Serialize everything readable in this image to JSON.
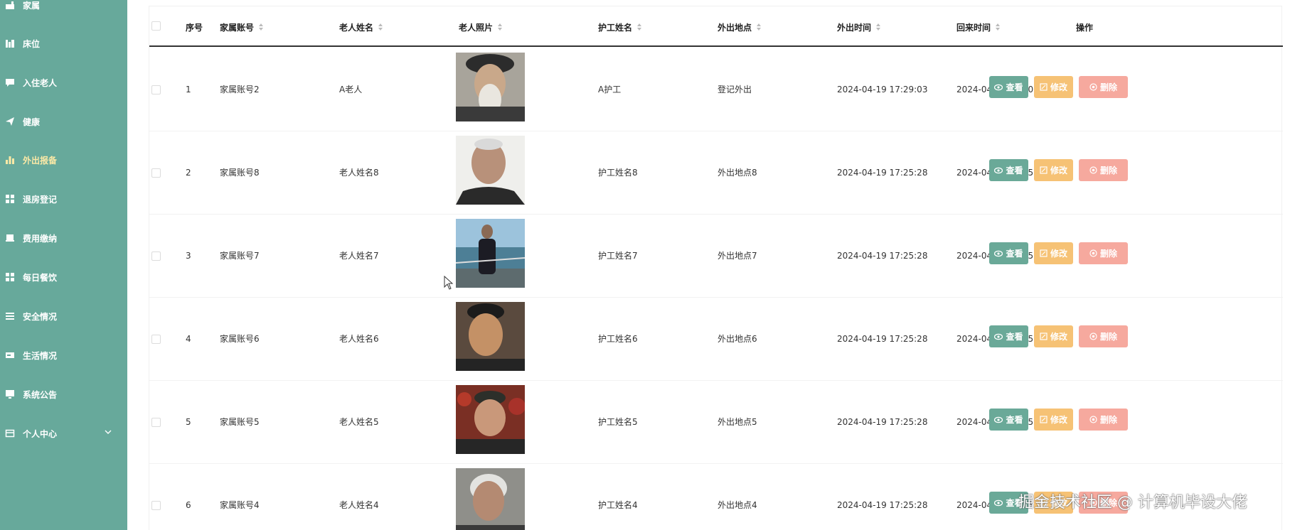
{
  "sidebar": {
    "items": [
      {
        "label": "家属",
        "icon": "family-icon"
      },
      {
        "label": "床位",
        "icon": "bed-icon"
      },
      {
        "label": "入住老人",
        "icon": "chat-icon"
      },
      {
        "label": "健康",
        "icon": "send-icon"
      },
      {
        "label": "外出报备",
        "icon": "bar-chart-icon",
        "active": true
      },
      {
        "label": "退房登记",
        "icon": "grid-icon"
      },
      {
        "label": "费用缴纳",
        "icon": "wallet-icon"
      },
      {
        "label": "每日餐饮",
        "icon": "grid-icon"
      },
      {
        "label": "安全情况",
        "icon": "list-icon"
      },
      {
        "label": "生活情况",
        "icon": "card-icon"
      },
      {
        "label": "系统公告",
        "icon": "monitor-icon"
      },
      {
        "label": "个人中心",
        "icon": "folder-icon"
      }
    ]
  },
  "table": {
    "headers": {
      "index": "序号",
      "family_account": "家属账号",
      "elder_name": "老人姓名",
      "elder_photo": "老人照片",
      "nurse_name": "护工姓名",
      "outing_place": "外出地点",
      "out_time": "外出时间",
      "return_time": "回来时间",
      "actions": "操作"
    },
    "rows": [
      {
        "index": "1",
        "family_account": "家属账号2",
        "elder_name": "A老人",
        "nurse_name": "A护工",
        "outing_place": "登记外出",
        "out_time": "2024-04-19 17:29:03",
        "return_time": "2024-04-30 00:00:00"
      },
      {
        "index": "2",
        "family_account": "家属账号8",
        "elder_name": "老人姓名8",
        "nurse_name": "护工姓名8",
        "outing_place": "外出地点8",
        "out_time": "2024-04-19 17:25:28",
        "return_time": "2024-04-19 17:25:28"
      },
      {
        "index": "3",
        "family_account": "家属账号7",
        "elder_name": "老人姓名7",
        "nurse_name": "护工姓名7",
        "outing_place": "外出地点7",
        "out_time": "2024-04-19 17:25:28",
        "return_time": "2024-04-19 17:25:28"
      },
      {
        "index": "4",
        "family_account": "家属账号6",
        "elder_name": "老人姓名6",
        "nurse_name": "护工姓名6",
        "outing_place": "外出地点6",
        "out_time": "2024-04-19 17:25:28",
        "return_time": "2024-04-19 17:25:28"
      },
      {
        "index": "5",
        "family_account": "家属账号5",
        "elder_name": "老人姓名5",
        "nurse_name": "护工姓名5",
        "outing_place": "外出地点5",
        "out_time": "2024-04-19 17:25:28",
        "return_time": "2024-04-19 17:25:28"
      },
      {
        "index": "6",
        "family_account": "家属账号4",
        "elder_name": "老人姓名4",
        "nurse_name": "护工姓名4",
        "outing_place": "外出地点4",
        "out_time": "2024-04-19 17:25:28",
        "return_time": "2024-04-19 17:25:28"
      }
    ],
    "actions": {
      "view": "查看",
      "edit": "修改",
      "delete": "删除"
    }
  },
  "watermark": "掘金技术社区 @ 计算机毕设大佬",
  "colors": {
    "sidebar_bg": "#67a99b",
    "active_menu": "#fbe9a6",
    "view_btn": "#6aa998",
    "edit_btn": "#f6c275",
    "delete_btn": "#f6a99e"
  }
}
